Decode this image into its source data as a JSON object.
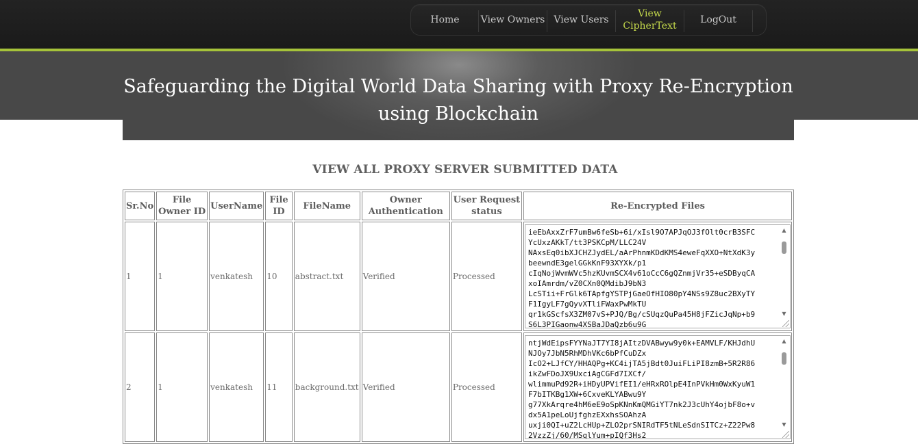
{
  "nav": {
    "items": [
      {
        "label": "Home"
      },
      {
        "label": "View Owners"
      },
      {
        "label": "View Users"
      },
      {
        "label": "View\nCipherText",
        "active": true
      },
      {
        "label": "LogOut"
      }
    ]
  },
  "site_title": "Safeguarding the Digital World Data Sharing with Proxy Re-Encryption using Blockchain",
  "page_heading": "VIEW ALL PROXY SERVER SUBMITTED DATA",
  "table": {
    "headers": [
      "Sr.No",
      "File Owner ID",
      "UserName",
      "File ID",
      "FileName",
      "Owner Authentication",
      "User Request status",
      "Re-Encrypted Files"
    ],
    "rows": [
      {
        "sr_no": "1",
        "owner_id": "1",
        "username": "venkatesh",
        "file_id": "10",
        "filename": "abstract.txt",
        "owner_auth": "Verified",
        "request_status": "Processed",
        "cipher": "ieEbAxxZrF7umBw6feSb+6i/xIsl9O7APJqOJ3fOlt0crB3SFC\nYcUxzAKkT/tt3PSKCpM/LLC24V\nNAxsEq0ibXJCHZJydEL/aArPhnmKDdKMS4eweFqXXO+NtXdK3y\nbeewndE3gelGGkKnF93XYXk/p1\ncIqNojWvmWVc5hzKUvmSCX4v61oCcC6gQZnmjVr35+eSDByqCA\nxoIAmrdm/vZ0CXn0QMdibJ9bN3\nLcSTii+FrGlk6TApfgYSTPjGaeOfHIO80pY4NSs9Z8uc2BXyTY\nF1IgyLF7gQyvXTliFWaxPwMkTU\nqr1kGScfsX3ZM07vS+PJQ/Bg/cSUqzQuPa45H8jFZicJqNp+b9\nS6L3PIGaonw4XSBaJDaQzb6u9G"
      },
      {
        "sr_no": "2",
        "owner_id": "1",
        "username": "venkatesh",
        "file_id": "11",
        "filename": "background.txt",
        "owner_auth": "Verified",
        "request_status": "Processed",
        "cipher": "ntjWdEipsFYYNaJT7YI8jAItzDVABwyw9y0k+EAMVLF/KHJdhU\nNJOy7JbN5RhMDhVKc6bPfCuDZx\nIcO2+LJfCY/HHAQPg+KC4ijTA5jBdt0JuiFLiPI8zmB+5R2R86\nikZwFDoJX9UxciAgCGFd7IXCf/\nwlimmuPd92R+iHDyUPVifEI1/eHRxROlpE4InPVkHm0WxKyuW1\nF7bITKBg1XW+6CxveKLYABwu9Y\ng77XkArqre4hM6eE9oSpKNnKmQMGiYT7nk2J3cUhY4ojbF8o+v\ndx5A1peLoUjfghzEXxhsSOAhzA\nuxji0QI+uZ2LcHUp+ZLO2prSNIRdTF5tNLeSdnSITCz+Z22Pw8\n2VzzZj/60/MSglYum+pIQf3Hs2"
      }
    ]
  }
}
